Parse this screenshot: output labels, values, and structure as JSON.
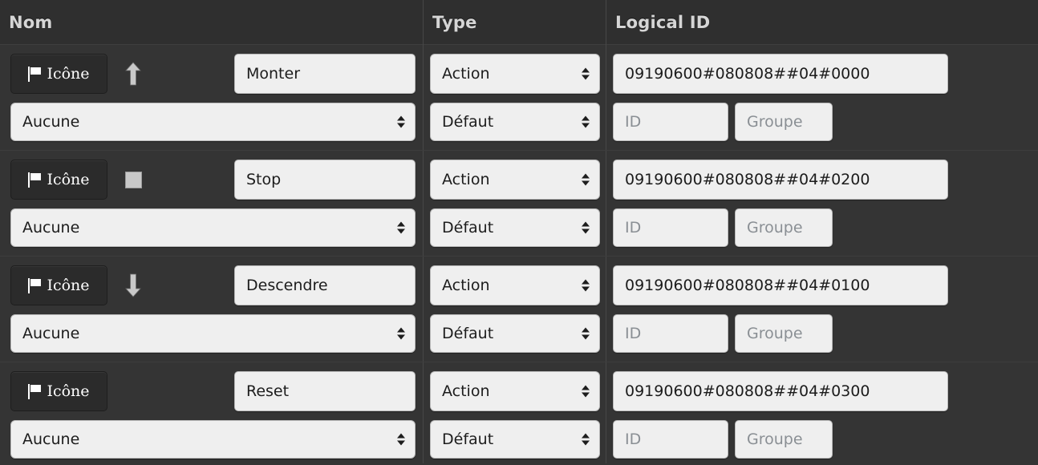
{
  "table": {
    "columns": [
      {
        "key": "nom",
        "label": "Nom"
      },
      {
        "key": "type",
        "label": "Type"
      },
      {
        "key": "lid",
        "label": "Logical ID"
      }
    ],
    "controls": {
      "icone_button_label": "Icône",
      "icone_button_icon": "flag-icon",
      "none_option": "Aucune",
      "id_placeholder": "ID",
      "group_placeholder": "Groupe"
    },
    "rows": [
      {
        "icon": "arrow-up-icon",
        "name": "Monter",
        "cmd_select": "Aucune",
        "type": "Action",
        "subtype": "Défaut",
        "logical_id": "09190600#080808##04#0000",
        "id_value": "",
        "group_value": ""
      },
      {
        "icon": "stop-square-icon",
        "name": "Stop",
        "cmd_select": "Aucune",
        "type": "Action",
        "subtype": "Défaut",
        "logical_id": "09190600#080808##04#0200",
        "id_value": "",
        "group_value": ""
      },
      {
        "icon": "arrow-down-icon",
        "name": "Descendre",
        "cmd_select": "Aucune",
        "type": "Action",
        "subtype": "Défaut",
        "logical_id": "09190600#080808##04#0100",
        "id_value": "",
        "group_value": ""
      },
      {
        "icon": "none",
        "name": "Reset",
        "cmd_select": "Aucune",
        "type": "Action",
        "subtype": "Défaut",
        "logical_id": "09190600#080808##04#0300",
        "id_value": "",
        "group_value": ""
      }
    ]
  },
  "colors": {
    "background": "#343434",
    "header_background": "#2f2f2f",
    "header_text": "#d6d6d6",
    "button_background": "#2b2b2b",
    "input_background": "#efefef",
    "placeholder_text": "#8a8f94"
  }
}
